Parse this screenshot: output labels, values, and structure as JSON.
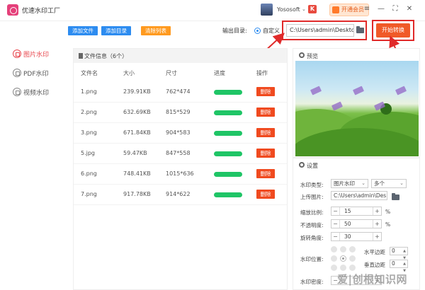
{
  "app": {
    "title": "优速水印工厂",
    "user": "Yososoft",
    "vip_label": "开通会员"
  },
  "sidebar": {
    "items": [
      {
        "label": "图片水印",
        "active": true
      },
      {
        "label": "PDF水印",
        "active": false
      },
      {
        "label": "视频水印",
        "active": false
      }
    ]
  },
  "toolbar": {
    "add_file": "添加文件",
    "add_dir": "添加目录",
    "clear_list": "清除列表",
    "output_label": "输出目录:",
    "custom_label": "自定义",
    "output_path": "C:\\Users\\admin\\Deskto",
    "start_label": "开始转换"
  },
  "file_panel": {
    "title": "文件信息（6个）",
    "columns": [
      "文件名",
      "大小",
      "尺寸",
      "进度",
      "操作"
    ],
    "rows": [
      {
        "name": "1.png",
        "size": "239.91KB",
        "dims": "762*474",
        "progress": 1.0,
        "action": "删除"
      },
      {
        "name": "2.png",
        "size": "632.69KB",
        "dims": "815*529",
        "progress": 1.0,
        "action": "删除"
      },
      {
        "name": "3.png",
        "size": "671.84KB",
        "dims": "904*583",
        "progress": 1.0,
        "action": "删除"
      },
      {
        "name": "5.jpg",
        "size": "59.47KB",
        "dims": "847*558",
        "progress": 1.0,
        "action": "删除"
      },
      {
        "name": "6.png",
        "size": "748.41KB",
        "dims": "1015*636",
        "progress": 1.0,
        "action": "删除"
      },
      {
        "name": "7.png",
        "size": "917.78KB",
        "dims": "914*622",
        "progress": 1.0,
        "action": "删除"
      }
    ]
  },
  "preview": {
    "title": "预览"
  },
  "settings": {
    "title": "设置",
    "wm_type_label": "水印类型:",
    "wm_type_value": "图片水印",
    "wm_count_value": "多个",
    "upload_label": "上传图片:",
    "upload_path": "C:\\Users\\admin\\Des",
    "scale_label": "缩放比例:",
    "scale_value": "15",
    "opacity_label": "不透明度:",
    "opacity_value": "50",
    "rotate_label": "旋转角度:",
    "rotate_value": "30",
    "percent": "%",
    "position_label": "水印位置:",
    "h_margin_label": "水平边距",
    "h_margin_value": "0",
    "v_margin_label": "垂直边距",
    "v_margin_value": "0",
    "density_label": "水印密度:"
  },
  "overlay": {
    "watermark": "爱|创根知识网"
  },
  "colors": {
    "accent_red": "#e8474e",
    "primary_blue": "#2d8cf0",
    "progress_green": "#1fc566",
    "start_orange": "#f05a28",
    "annotation_red": "#e02a2a"
  }
}
